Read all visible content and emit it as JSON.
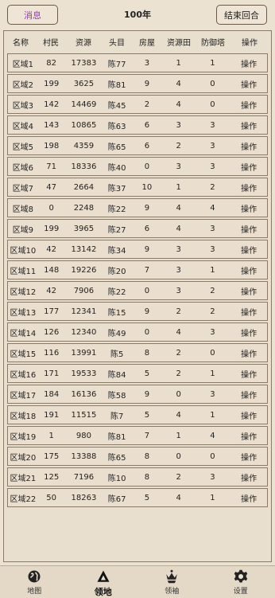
{
  "header": {
    "message_button": "消息",
    "year": "100年",
    "end_turn_button": "结束回合"
  },
  "table": {
    "columns": [
      "名称",
      "村民",
      "资源",
      "头目",
      "房屋",
      "资源田",
      "防御塔",
      "操作"
    ],
    "rows": [
      [
        "区域1",
        "82",
        "17383",
        "陈77",
        "3",
        "1",
        "1",
        "操作"
      ],
      [
        "区域2",
        "199",
        "3625",
        "陈81",
        "9",
        "4",
        "0",
        "操作"
      ],
      [
        "区域3",
        "142",
        "14469",
        "陈45",
        "2",
        "4",
        "0",
        "操作"
      ],
      [
        "区域4",
        "143",
        "10865",
        "陈63",
        "6",
        "3",
        "3",
        "操作"
      ],
      [
        "区域5",
        "198",
        "4359",
        "陈65",
        "6",
        "2",
        "3",
        "操作"
      ],
      [
        "区域6",
        "71",
        "18336",
        "陈40",
        "0",
        "3",
        "3",
        "操作"
      ],
      [
        "区域7",
        "47",
        "2664",
        "陈37",
        "10",
        "1",
        "2",
        "操作"
      ],
      [
        "区域8",
        "0",
        "2248",
        "陈22",
        "9",
        "4",
        "4",
        "操作"
      ],
      [
        "区域9",
        "199",
        "3965",
        "陈27",
        "6",
        "4",
        "3",
        "操作"
      ],
      [
        "区域10",
        "42",
        "13142",
        "陈34",
        "9",
        "3",
        "3",
        "操作"
      ],
      [
        "区域11",
        "148",
        "19226",
        "陈20",
        "7",
        "3",
        "1",
        "操作"
      ],
      [
        "区域12",
        "42",
        "7906",
        "陈22",
        "0",
        "3",
        "2",
        "操作"
      ],
      [
        "区域13",
        "177",
        "12341",
        "陈15",
        "9",
        "2",
        "2",
        "操作"
      ],
      [
        "区域14",
        "126",
        "12340",
        "陈49",
        "0",
        "4",
        "3",
        "操作"
      ],
      [
        "区域15",
        "116",
        "13991",
        "陈5",
        "8",
        "2",
        "0",
        "操作"
      ],
      [
        "区域16",
        "171",
        "19533",
        "陈84",
        "5",
        "2",
        "1",
        "操作"
      ],
      [
        "区域17",
        "184",
        "16136",
        "陈58",
        "9",
        "0",
        "3",
        "操作"
      ],
      [
        "区域18",
        "191",
        "11515",
        "陈7",
        "5",
        "4",
        "1",
        "操作"
      ],
      [
        "区域19",
        "1",
        "980",
        "陈81",
        "7",
        "1",
        "4",
        "操作"
      ],
      [
        "区域20",
        "175",
        "13388",
        "陈65",
        "8",
        "0",
        "0",
        "操作"
      ],
      [
        "区域21",
        "125",
        "7196",
        "陈10",
        "8",
        "2",
        "3",
        "操作"
      ],
      [
        "区域22",
        "50",
        "18263",
        "陈67",
        "5",
        "4",
        "1",
        "操作"
      ]
    ]
  },
  "nav": {
    "items": [
      {
        "label": "地图",
        "icon": "globe-icon"
      },
      {
        "label": "领地",
        "icon": "triangle-icon"
      },
      {
        "label": "领袖",
        "icon": "crown-icon"
      },
      {
        "label": "设置",
        "icon": "gear-icon"
      }
    ],
    "active_index": 1
  }
}
